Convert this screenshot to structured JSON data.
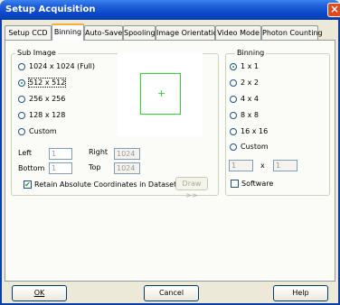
{
  "window": {
    "title": "Setup Acquisition",
    "close_glyph": "×"
  },
  "tabs": [
    {
      "label": "Setup CCD"
    },
    {
      "label": "Binning"
    },
    {
      "label": "Auto-Save"
    },
    {
      "label": "Spooling"
    },
    {
      "label": "Image Orientation"
    },
    {
      "label": "Video Mode"
    },
    {
      "label": "Photon Counting"
    }
  ],
  "active_tab": "Binning",
  "sub_image": {
    "group_label": "Sub Image",
    "options": [
      {
        "label": "1024 x 1024 (Full)",
        "selected": false
      },
      {
        "label": "512 x 512",
        "selected": true
      },
      {
        "label": "256 x 256",
        "selected": false
      },
      {
        "label": "128 x 128",
        "selected": false
      },
      {
        "label": "Custom",
        "selected": false
      }
    ],
    "preview_cross": "+",
    "left_label": "Left",
    "left_value": "1",
    "right_label": "Right",
    "right_value": "1024",
    "bottom_label": "Bottom",
    "bottom_value": "1",
    "top_label": "Top",
    "top_value": "1024",
    "retain_label": "Retain Absolute Coordinates in Dataset",
    "retain_checked": true,
    "draw_button": "Draw >>"
  },
  "binning": {
    "group_label": "Binning",
    "options": [
      {
        "label": "1 x 1",
        "selected": true
      },
      {
        "label": "2 x 2",
        "selected": false
      },
      {
        "label": "4 x 4",
        "selected": false
      },
      {
        "label": "8 x 8",
        "selected": false
      },
      {
        "label": "16 x 16",
        "selected": false
      },
      {
        "label": "Custom",
        "selected": false
      }
    ],
    "custom_x_value": "1",
    "x_label": "x",
    "custom_y_value": "1",
    "software_label": "Software",
    "software_checked": false
  },
  "buttons": {
    "ok": "OK",
    "cancel": "Cancel",
    "help": "Help"
  }
}
